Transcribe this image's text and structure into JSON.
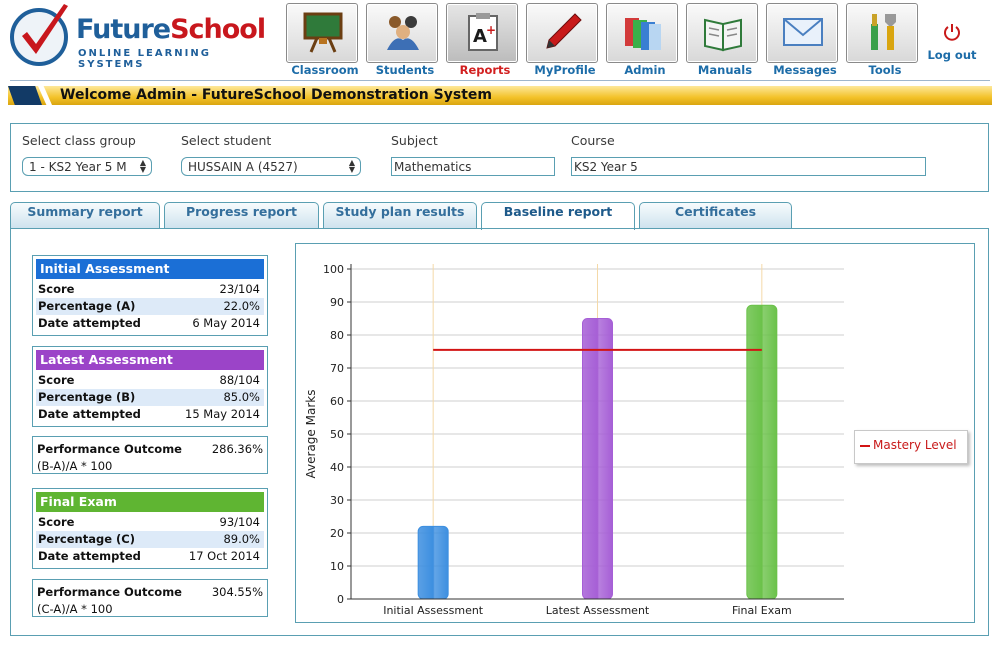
{
  "brand": {
    "name_part1": "Future",
    "name_part2": "School",
    "tagline": "ONLINE LEARNING SYSTEMS"
  },
  "nav": {
    "items": [
      {
        "label": "Classroom",
        "icon": "chalkboard-icon"
      },
      {
        "label": "Students",
        "icon": "students-icon"
      },
      {
        "label": "Reports",
        "icon": "report-card-icon",
        "active": true
      },
      {
        "label": "MyProfile",
        "icon": "pen-icon"
      },
      {
        "label": "Admin",
        "icon": "folders-icon"
      },
      {
        "label": "Manuals",
        "icon": "book-icon"
      },
      {
        "label": "Messages",
        "icon": "envelope-icon"
      },
      {
        "label": "Tools",
        "icon": "tools-icon"
      }
    ],
    "logout_label": "Log out"
  },
  "welcome": "Welcome Admin - FutureSchool Demonstration System",
  "selectors": {
    "class_group_label": "Select class group",
    "class_group_value": "1 - KS2 Year 5 M",
    "student_label": "Select student",
    "student_value": "HUSSAIN A (4527)",
    "subject_label": "Subject",
    "subject_value": "Mathematics",
    "course_label": "Course",
    "course_value": "KS2 Year 5"
  },
  "tabs": [
    "Summary report",
    "Progress report",
    "Study plan results",
    "Baseline report",
    "Certificates"
  ],
  "active_tab": "Baseline report",
  "initial": {
    "title": "Initial Assessment",
    "score_label": "Score",
    "score": "23/104",
    "pct_label": "Percentage (A)",
    "pct": "22.0%",
    "date_label": "Date attempted",
    "date": "6 May 2014",
    "color": "#1b6fd6"
  },
  "latest": {
    "title": "Latest Assessment",
    "score_label": "Score",
    "score": "88/104",
    "pct_label": "Percentage (B)",
    "pct": "85.0%",
    "date_label": "Date attempted",
    "date": "15 May 2014",
    "color": "#9b44c8"
  },
  "perf1": {
    "label": "Performance Outcome",
    "value": "286.36%",
    "formula": "(B-A)/A * 100"
  },
  "final": {
    "title": "Final Exam",
    "score_label": "Score",
    "score": "93/104",
    "pct_label": "Percentage (C)",
    "pct": "89.0%",
    "date_label": "Date attempted",
    "date": "17 Oct 2014",
    "color": "#5fb532"
  },
  "perf2": {
    "label": "Performance Outcome",
    "value": "304.55%",
    "formula": "(C-A)/A * 100"
  },
  "chart_data": {
    "type": "bar",
    "categories": [
      "Initial Assessment",
      "Latest Assessment",
      "Final Exam"
    ],
    "values": [
      22,
      85,
      89
    ],
    "colors": [
      "#3d8fe0",
      "#a65fd6",
      "#6bc24a"
    ],
    "ylabel": "Average Marks",
    "ylim": [
      0,
      100
    ],
    "yticks": [
      0,
      10,
      20,
      30,
      40,
      50,
      60,
      70,
      80,
      90,
      100
    ],
    "grid": true,
    "mastery_level": 75.5,
    "mastery_color": "#d21414",
    "legend": {
      "label": "Mastery Level",
      "placement": "right"
    }
  }
}
